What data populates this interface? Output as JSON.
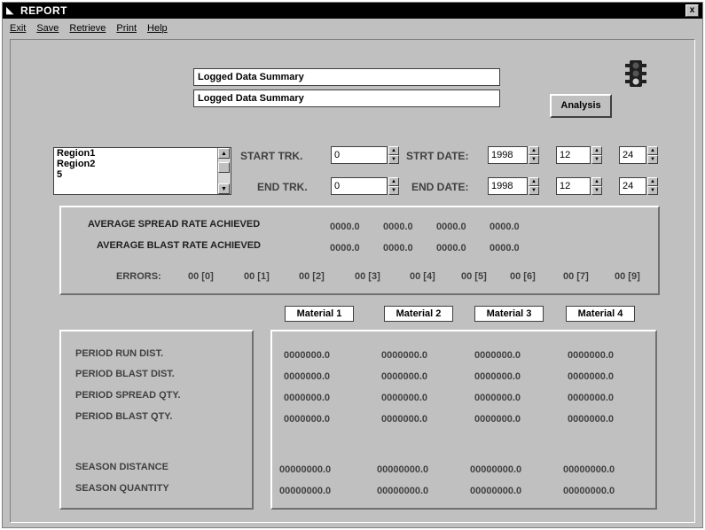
{
  "window": {
    "title": "REPORT",
    "close_glyph": "x"
  },
  "menu": [
    "Exit",
    "Save",
    "Retrieve",
    "Print",
    "Help"
  ],
  "summary_lines": [
    "Logged Data Summary",
    "Logged Data Summary"
  ],
  "analysis_button": "Analysis",
  "region_list": [
    "Region1",
    "Region2",
    "5"
  ],
  "track": {
    "start_label": "START TRK.",
    "start_value": "0",
    "end_label": "END TRK.",
    "end_value": "0"
  },
  "dates": {
    "start_label": "STRT DATE:",
    "end_label": "END DATE:",
    "start": {
      "year": "1998",
      "month": "12",
      "day": "24"
    },
    "end": {
      "year": "1998",
      "month": "12",
      "day": "24"
    }
  },
  "rates": {
    "spread_label": "AVERAGE SPREAD RATE ACHIEVED",
    "blast_label": "AVERAGE BLAST RATE ACHIEVED",
    "spread_values": [
      "0000.0",
      "0000.0",
      "0000.0",
      "0000.0"
    ],
    "blast_values": [
      "0000.0",
      "0000.0",
      "0000.0",
      "0000.0"
    ],
    "errors_label": "ERRORS:",
    "errors": [
      "00 [0]",
      "00 [1]",
      "00 [2]",
      "00 [3]",
      "00 [4]",
      "00 [5]",
      "00 [6]",
      "00 [7]",
      "00 [9]"
    ]
  },
  "materials": [
    "Material 1",
    "Material 2",
    "Material 3",
    "Material 4"
  ],
  "rows": [
    {
      "label": "PERIOD RUN DIST.",
      "values": [
        "0000000.0",
        "0000000.0",
        "0000000.0",
        "0000000.0"
      ]
    },
    {
      "label": "PERIOD BLAST DIST.",
      "values": [
        "0000000.0",
        "0000000.0",
        "0000000.0",
        "0000000.0"
      ]
    },
    {
      "label": "PERIOD SPREAD QTY.",
      "values": [
        "0000000.0",
        "0000000.0",
        "0000000.0",
        "0000000.0"
      ]
    },
    {
      "label": "PERIOD BLAST QTY.",
      "values": [
        "0000000.0",
        "0000000.0",
        "0000000.0",
        "0000000.0"
      ]
    },
    {
      "label": "SEASON DISTANCE",
      "values": [
        "00000000.0",
        "00000000.0",
        "00000000.0",
        "00000000.0"
      ]
    },
    {
      "label": "SEASON QUANTITY",
      "values": [
        "00000000.0",
        "00000000.0",
        "00000000.0",
        "00000000.0"
      ]
    }
  ],
  "icons": {
    "app": "window-icon",
    "status": "traffic-light-icon"
  },
  "colors": {
    "titlebar": "#000000",
    "face": "#c0c0c0",
    "field": "#ffffff"
  }
}
